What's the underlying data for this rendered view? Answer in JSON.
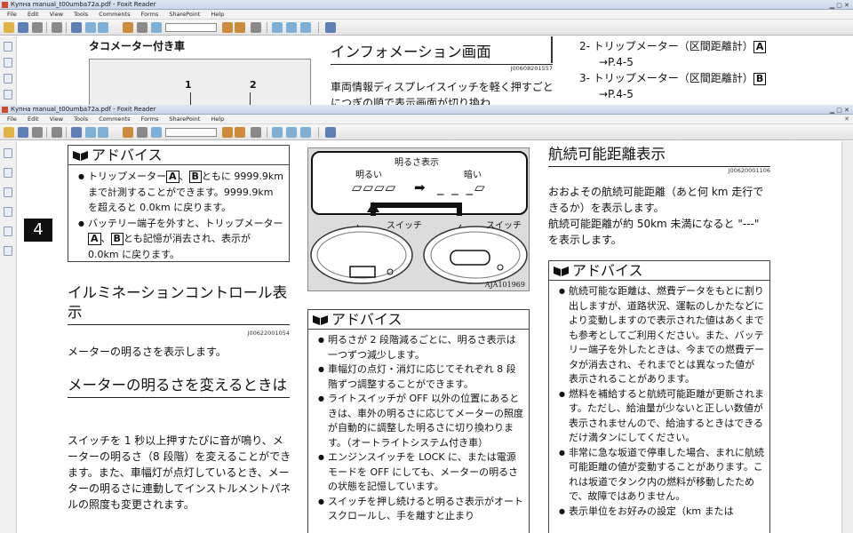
{
  "window1": {
    "title": "Купна manual_t00umba72a.pdf - Foxit Reader",
    "menu": [
      "File",
      "Edit",
      "View",
      "Tools",
      "Comments",
      "Forms",
      "SharePoint",
      "Help"
    ],
    "page": {
      "tacho_label": "タコメーター付き車",
      "callouts": [
        "1",
        "2"
      ],
      "heading": "インフォメーション画面",
      "code": "J00608201557",
      "body": "車両情報ディスプレイスイッチを軽く押すごとにつぎの順で表示画面が切り換わ",
      "list": [
        {
          "num": "2-",
          "text": "トリップメーター（区間距離計）",
          "letter": "A",
          "ref": "→P.4-5"
        },
        {
          "num": "3-",
          "text": "トリップメーター（区間距離計）",
          "letter": "B",
          "ref": "→P.4-5"
        }
      ]
    }
  },
  "window2": {
    "title": "Купна manual_t00umba72a.pdf - Foxit Reader",
    "menu": [
      "File",
      "Edit",
      "View",
      "Tools",
      "Comments",
      "Forms",
      "SharePoint",
      "Help"
    ],
    "chapter_tab": "4",
    "left": {
      "advice_title": "アドバイス",
      "advice_items": [
        {
          "pre": "トリップメーター",
          "a": "A",
          "sep": "、",
          "b": "B",
          "post": "ともに 9999.9km まで計測することができます。9999.9km を超えると 0.0km に戻ります。"
        },
        {
          "pre": "バッテリー端子を外すと、トリップメーター",
          "a": "A",
          "sep": "、",
          "b": "B",
          "post": "とも記憶が消去され、表示が 0.0km に戻ります。"
        }
      ],
      "illum_heading": "イルミネーションコントロール表示",
      "illum_code": "J00622001054",
      "illum_body": "メーターの明るさを表示します。",
      "change_heading": "メーターの明るさを変えるときは",
      "change_body": "スイッチを 1 秒以上押すたびに音が鳴り、メーターの明るさ（8 段階）を変えることができます。また、車幅灯が点灯しているとき、メーターの明るさに連動してインストルメントパネルの照度も変更されます。"
    },
    "figure": {
      "title": "明るさ表示",
      "bright": "明るい",
      "dark": "暗い",
      "switch_left": "スイッチ",
      "switch_right": "スイッチ",
      "code": "AJA101969"
    },
    "middle": {
      "advice_title": "アドバイス",
      "advice_items": [
        "明るさが 2 段階減るごとに、明るさ表示は一つずつ減少します。",
        "車幅灯の点灯・消灯に応じてそれぞれ 8 段階ずつ調整することができます。",
        "ライトスイッチが OFF 以外の位置にあるときは、車外の明るさに応じてメーターの照度が自動的に調整した明るさに切り換わります。（オートライトシステム付き車）",
        "エンジンスイッチを LOCK に、または電源モードを OFF にしても、メーターの明るさの状態を記憶しています。",
        "スイッチを押し続けると明るさ表示がオートスクロールし、手を離すと止まり"
      ]
    },
    "right": {
      "range_heading": "航続可能距離表示",
      "range_code": "J00620001106",
      "range_body1": "おおよその航続可能距離（あと何 km 走行できるか）を表示します。",
      "range_body2": "航続可能距離が約 50km 未満になると \"---\" を表示します。",
      "advice_title": "アドバイス",
      "advice_items": [
        "航続可能な距離は、燃費データをもとに割り出しますが、道路状況、運転のしかたなどにより変動しますので表示された値はあくまでも参考としてご利用ください。また、バッテリー端子を外したときは、今までの燃費データが消去され、それまでとは異なった値が表示されることがあります。",
        "燃料を補給すると航続可能距離が更新されます。ただし、給油量が少ないと正しい数値が表示されませんので、給油するときはできるだけ満タンにしてください。",
        "非常に急な坂道で停車した場合、まれに航続可能距離の値が変動することがあります。これは坂道でタンク内の燃料が移動したためで、故障ではありません。",
        "表示単位をお好みの設定（km または"
      ]
    }
  }
}
